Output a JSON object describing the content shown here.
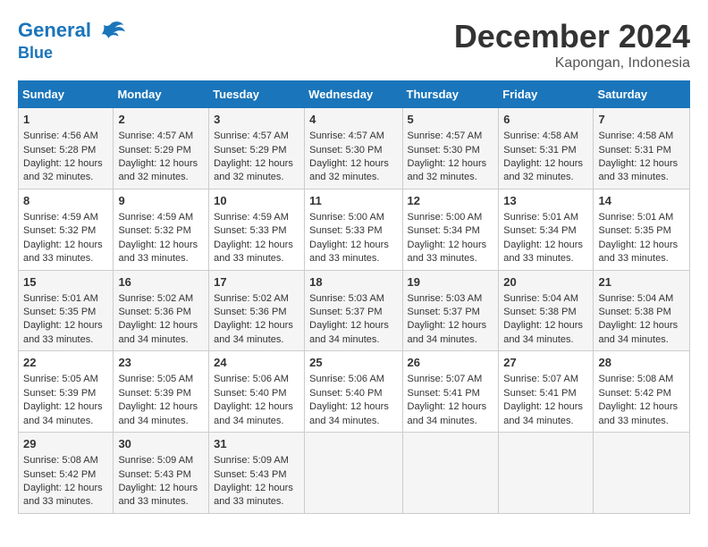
{
  "header": {
    "logo_line1": "General",
    "logo_line2": "Blue",
    "month": "December 2024",
    "location": "Kapongan, Indonesia"
  },
  "weekdays": [
    "Sunday",
    "Monday",
    "Tuesday",
    "Wednesday",
    "Thursday",
    "Friday",
    "Saturday"
  ],
  "weeks": [
    [
      {
        "day": "1",
        "sunrise": "4:56 AM",
        "sunset": "5:28 PM",
        "daylight": "12 hours and 32 minutes."
      },
      {
        "day": "2",
        "sunrise": "4:57 AM",
        "sunset": "5:29 PM",
        "daylight": "12 hours and 32 minutes."
      },
      {
        "day": "3",
        "sunrise": "4:57 AM",
        "sunset": "5:29 PM",
        "daylight": "12 hours and 32 minutes."
      },
      {
        "day": "4",
        "sunrise": "4:57 AM",
        "sunset": "5:30 PM",
        "daylight": "12 hours and 32 minutes."
      },
      {
        "day": "5",
        "sunrise": "4:57 AM",
        "sunset": "5:30 PM",
        "daylight": "12 hours and 32 minutes."
      },
      {
        "day": "6",
        "sunrise": "4:58 AM",
        "sunset": "5:31 PM",
        "daylight": "12 hours and 32 minutes."
      },
      {
        "day": "7",
        "sunrise": "4:58 AM",
        "sunset": "5:31 PM",
        "daylight": "12 hours and 33 minutes."
      }
    ],
    [
      {
        "day": "8",
        "sunrise": "4:59 AM",
        "sunset": "5:32 PM",
        "daylight": "12 hours and 33 minutes."
      },
      {
        "day": "9",
        "sunrise": "4:59 AM",
        "sunset": "5:32 PM",
        "daylight": "12 hours and 33 minutes."
      },
      {
        "day": "10",
        "sunrise": "4:59 AM",
        "sunset": "5:33 PM",
        "daylight": "12 hours and 33 minutes."
      },
      {
        "day": "11",
        "sunrise": "5:00 AM",
        "sunset": "5:33 PM",
        "daylight": "12 hours and 33 minutes."
      },
      {
        "day": "12",
        "sunrise": "5:00 AM",
        "sunset": "5:34 PM",
        "daylight": "12 hours and 33 minutes."
      },
      {
        "day": "13",
        "sunrise": "5:01 AM",
        "sunset": "5:34 PM",
        "daylight": "12 hours and 33 minutes."
      },
      {
        "day": "14",
        "sunrise": "5:01 AM",
        "sunset": "5:35 PM",
        "daylight": "12 hours and 33 minutes."
      }
    ],
    [
      {
        "day": "15",
        "sunrise": "5:01 AM",
        "sunset": "5:35 PM",
        "daylight": "12 hours and 33 minutes."
      },
      {
        "day": "16",
        "sunrise": "5:02 AM",
        "sunset": "5:36 PM",
        "daylight": "12 hours and 34 minutes."
      },
      {
        "day": "17",
        "sunrise": "5:02 AM",
        "sunset": "5:36 PM",
        "daylight": "12 hours and 34 minutes."
      },
      {
        "day": "18",
        "sunrise": "5:03 AM",
        "sunset": "5:37 PM",
        "daylight": "12 hours and 34 minutes."
      },
      {
        "day": "19",
        "sunrise": "5:03 AM",
        "sunset": "5:37 PM",
        "daylight": "12 hours and 34 minutes."
      },
      {
        "day": "20",
        "sunrise": "5:04 AM",
        "sunset": "5:38 PM",
        "daylight": "12 hours and 34 minutes."
      },
      {
        "day": "21",
        "sunrise": "5:04 AM",
        "sunset": "5:38 PM",
        "daylight": "12 hours and 34 minutes."
      }
    ],
    [
      {
        "day": "22",
        "sunrise": "5:05 AM",
        "sunset": "5:39 PM",
        "daylight": "12 hours and 34 minutes."
      },
      {
        "day": "23",
        "sunrise": "5:05 AM",
        "sunset": "5:39 PM",
        "daylight": "12 hours and 34 minutes."
      },
      {
        "day": "24",
        "sunrise": "5:06 AM",
        "sunset": "5:40 PM",
        "daylight": "12 hours and 34 minutes."
      },
      {
        "day": "25",
        "sunrise": "5:06 AM",
        "sunset": "5:40 PM",
        "daylight": "12 hours and 34 minutes."
      },
      {
        "day": "26",
        "sunrise": "5:07 AM",
        "sunset": "5:41 PM",
        "daylight": "12 hours and 34 minutes."
      },
      {
        "day": "27",
        "sunrise": "5:07 AM",
        "sunset": "5:41 PM",
        "daylight": "12 hours and 34 minutes."
      },
      {
        "day": "28",
        "sunrise": "5:08 AM",
        "sunset": "5:42 PM",
        "daylight": "12 hours and 33 minutes."
      }
    ],
    [
      {
        "day": "29",
        "sunrise": "5:08 AM",
        "sunset": "5:42 PM",
        "daylight": "12 hours and 33 minutes."
      },
      {
        "day": "30",
        "sunrise": "5:09 AM",
        "sunset": "5:43 PM",
        "daylight": "12 hours and 33 minutes."
      },
      {
        "day": "31",
        "sunrise": "5:09 AM",
        "sunset": "5:43 PM",
        "daylight": "12 hours and 33 minutes."
      },
      null,
      null,
      null,
      null
    ]
  ],
  "labels": {
    "sunrise_prefix": "Sunrise: ",
    "sunset_prefix": "Sunset: ",
    "daylight_prefix": "Daylight: "
  }
}
